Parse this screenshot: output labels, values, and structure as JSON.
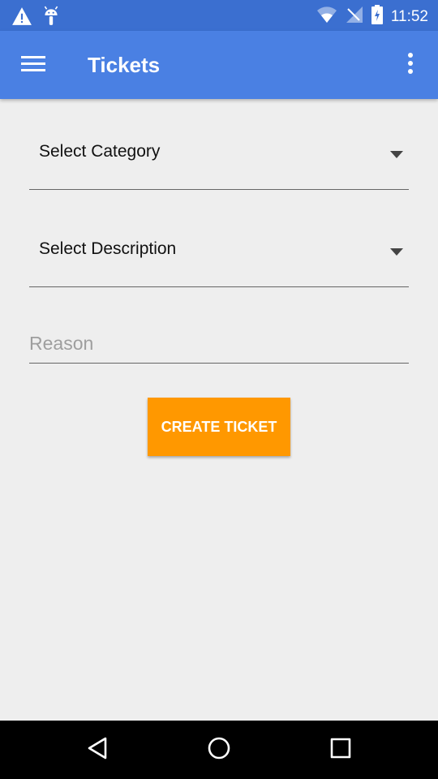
{
  "status_bar": {
    "time": "11:52",
    "left_icons": [
      "warning-icon",
      "android-icon"
    ],
    "right_icons": [
      "wifi-icon",
      "signal-icon",
      "battery-icon"
    ]
  },
  "app_bar": {
    "title": "Tickets",
    "menu_icon": "hamburger-menu-icon",
    "overflow_icon": "more-vertical-icon",
    "color": "#4a80e3"
  },
  "form": {
    "category": {
      "selected": "Select Category"
    },
    "description": {
      "selected": "Select Description"
    },
    "reason": {
      "placeholder": "Reason",
      "value": ""
    },
    "create_button": {
      "label": "CREATE TICKET",
      "color": "#ff9800"
    }
  },
  "nav_bar": {
    "buttons": [
      "back-icon",
      "home-icon",
      "recents-icon"
    ]
  }
}
